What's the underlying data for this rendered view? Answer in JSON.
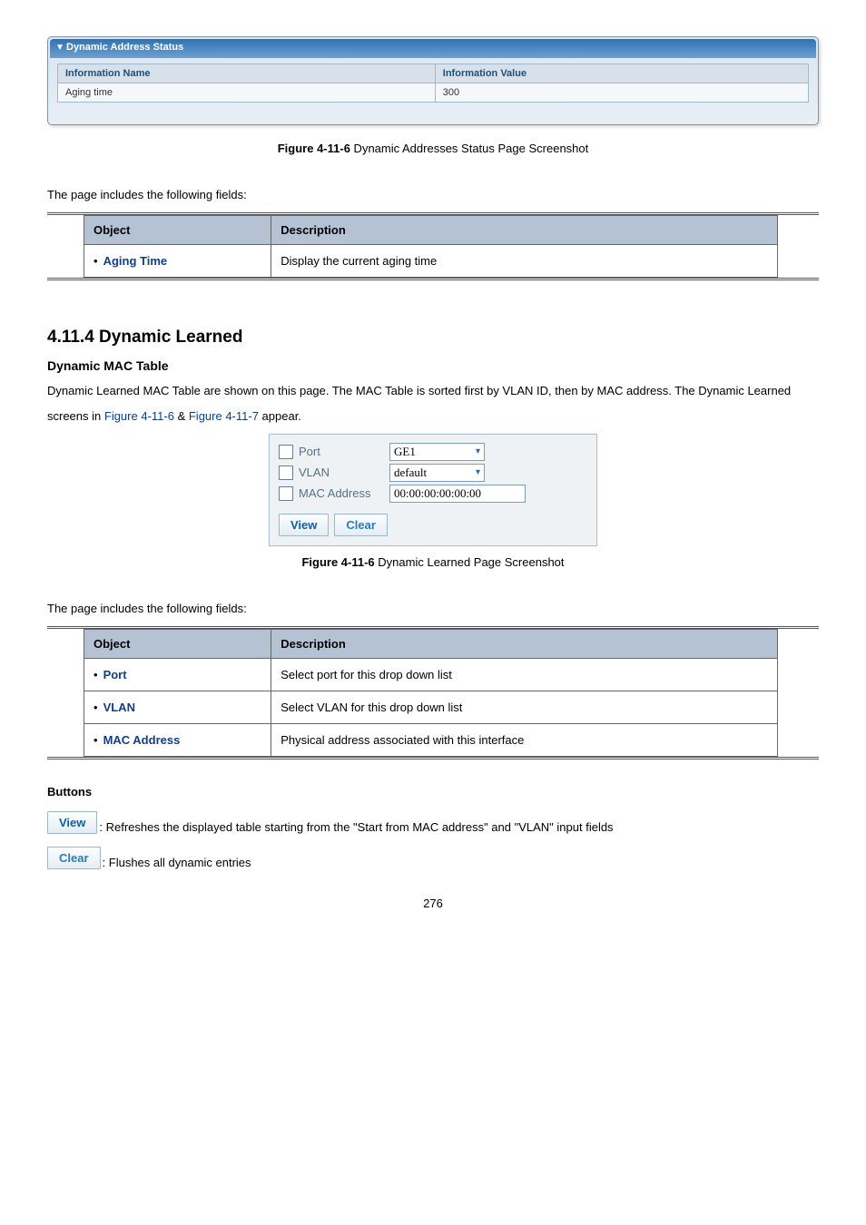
{
  "das_panel": {
    "title": "Dynamic Address Status",
    "col_name": "Information Name",
    "col_value": "Information Value",
    "row_name": "Aging time",
    "row_value": "300"
  },
  "caption_1": {
    "bold": "Figure 4-11-6",
    "rest": " Dynamic Addresses Status Page Screenshot"
  },
  "text_intro_1": "The page includes the following fields:",
  "table1": {
    "h_obj": "Object",
    "h_desc": "Description",
    "rows": [
      {
        "obj": "Aging Time",
        "desc": "Display the current aging time"
      }
    ]
  },
  "section_heading": "4.11.4 Dynamic Learned",
  "subsection_heading": "Dynamic MAC Table",
  "para_1a": "Dynamic Learned MAC Table are shown on this page. The MAC Table is sorted first by VLAN ID, then by MAC address. The Dynamic Learned screens in ",
  "link1": "Figure 4-11-6",
  "amp": " & ",
  "link2": "Figure 4-11-7",
  "para_1b": " appear.",
  "filter": {
    "port_label": "Port",
    "port_value": "GE1",
    "vlan_label": "VLAN",
    "vlan_value": "default",
    "mac_label": "MAC Address",
    "mac_value": "00:00:00:00:00:00",
    "view_btn": "View",
    "clear_btn": "Clear"
  },
  "caption_2": {
    "bold": "Figure 4-11-6",
    "rest": " Dynamic Learned Page Screenshot"
  },
  "text_intro_2": "The page includes the following fields:",
  "table2": {
    "h_obj": "Object",
    "h_desc": "Description",
    "rows": [
      {
        "obj": "Port",
        "desc": "Select port for this drop down list"
      },
      {
        "obj": "VLAN",
        "desc": "Select VLAN for this drop down list"
      },
      {
        "obj": "MAC Address",
        "desc": "Physical address associated with this interface"
      }
    ]
  },
  "buttons_heading": "Buttons",
  "view_btn": "View",
  "view_desc": ": Refreshes the displayed table starting from the \"Start from MAC address\" and \"VLAN\" input fields",
  "clear_btn": "Clear",
  "clear_desc": ": Flushes all dynamic entries",
  "page_no": "276"
}
